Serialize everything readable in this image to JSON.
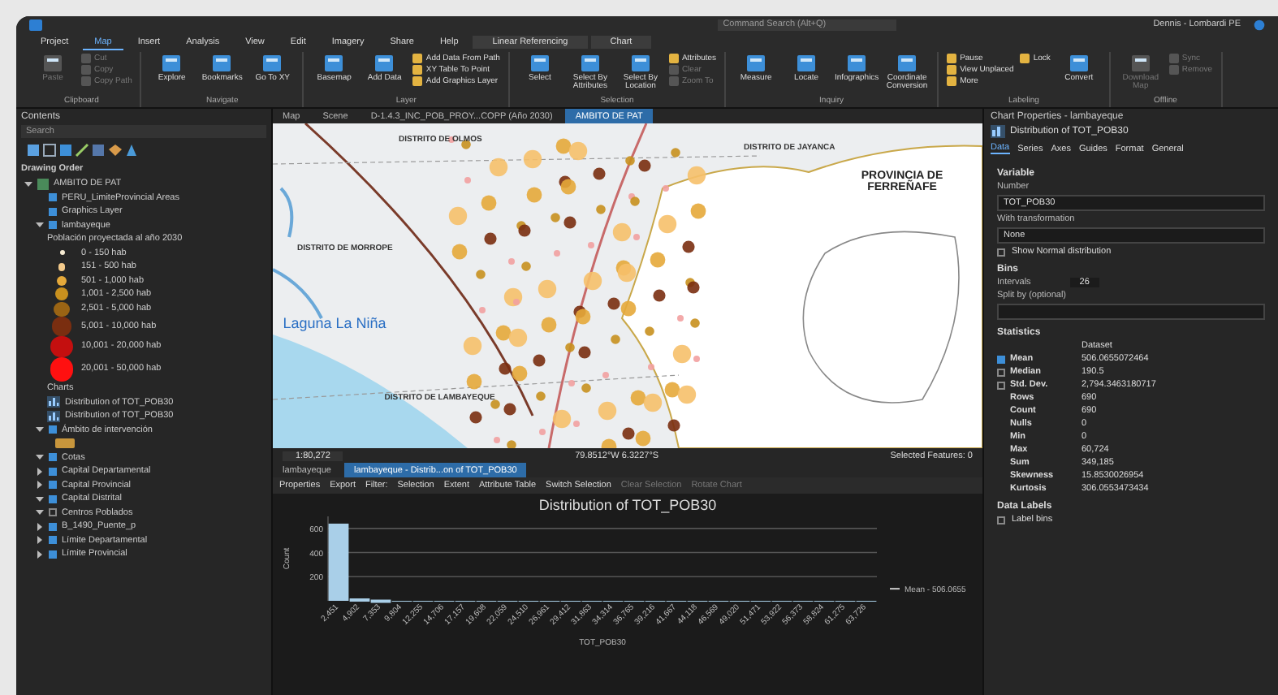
{
  "title_bar": {
    "search": {
      "placeholder": "Command Search (Alt+Q)"
    },
    "user": "Dennis - Lombardi PE"
  },
  "ribbon": {
    "tabs": [
      {
        "label": "Project",
        "selected": false,
        "kind": "normal"
      },
      {
        "label": "Map",
        "selected": true,
        "kind": "normal"
      },
      {
        "label": "Insert",
        "selected": false,
        "kind": "normal"
      },
      {
        "label": "Analysis",
        "selected": false,
        "kind": "normal"
      },
      {
        "label": "View",
        "selected": false,
        "kind": "normal"
      },
      {
        "label": "Edit",
        "selected": false,
        "kind": "normal"
      },
      {
        "label": "Imagery",
        "selected": false,
        "kind": "normal"
      },
      {
        "label": "Share",
        "selected": false,
        "kind": "normal"
      },
      {
        "label": "Help",
        "selected": false,
        "kind": "normal"
      },
      {
        "label": "Linear Referencing",
        "selected": false,
        "kind": "contextual"
      },
      {
        "label": "Chart",
        "selected": false,
        "kind": "contextual"
      }
    ],
    "groups": [
      {
        "label": "Clipboard",
        "buttons": [
          {
            "label": "Paste",
            "kind": "large",
            "disabled": true
          },
          {
            "label": "Cut",
            "kind": "small",
            "disabled": true
          },
          {
            "label": "Copy",
            "kind": "small",
            "disabled": true
          },
          {
            "label": "Copy Path",
            "kind": "small",
            "disabled": true
          }
        ]
      },
      {
        "label": "Navigate",
        "buttons": [
          {
            "label": "Explore",
            "kind": "large",
            "disabled": false
          },
          {
            "label": "Bookmarks",
            "kind": "large",
            "disabled": false
          },
          {
            "label": "Go To XY",
            "kind": "large",
            "disabled": false
          }
        ]
      },
      {
        "label": "Layer",
        "buttons": [
          {
            "label": "Basemap",
            "kind": "large",
            "disabled": false
          },
          {
            "label": "Add Data",
            "kind": "large",
            "disabled": false
          },
          {
            "label": "Add Data From Path",
            "kind": "small",
            "disabled": false
          },
          {
            "label": "XY Table To Point",
            "kind": "small",
            "disabled": false
          },
          {
            "label": "Add Graphics Layer",
            "kind": "small",
            "disabled": false
          }
        ]
      },
      {
        "label": "Selection",
        "buttons": [
          {
            "label": "Select",
            "kind": "large",
            "disabled": false
          },
          {
            "label": "Select By Attributes",
            "kind": "large",
            "disabled": false
          },
          {
            "label": "Select By Location",
            "kind": "large",
            "disabled": false
          },
          {
            "label": "Attributes",
            "kind": "small",
            "disabled": false
          },
          {
            "label": "Clear",
            "kind": "small",
            "disabled": true
          },
          {
            "label": "Zoom To",
            "kind": "small",
            "disabled": true
          }
        ]
      },
      {
        "label": "Inquiry",
        "buttons": [
          {
            "label": "Measure",
            "kind": "large",
            "disabled": false
          },
          {
            "label": "Locate",
            "kind": "large",
            "disabled": false
          },
          {
            "label": "Infographics",
            "kind": "large",
            "disabled": false
          },
          {
            "label": "Coordinate Conversion",
            "kind": "large",
            "disabled": false
          }
        ]
      },
      {
        "label": "Labeling",
        "buttons": [
          {
            "label": "Pause",
            "kind": "small",
            "disabled": false
          },
          {
            "label": "View Unplaced",
            "kind": "small",
            "disabled": false
          },
          {
            "label": "More",
            "kind": "small",
            "disabled": false
          },
          {
            "label": "Lock",
            "kind": "small",
            "disabled": false
          },
          {
            "label": "Convert",
            "kind": "large",
            "disabled": false
          }
        ]
      },
      {
        "label": "Offline",
        "buttons": [
          {
            "label": "Download Map",
            "kind": "large",
            "disabled": true
          },
          {
            "label": "Sync",
            "kind": "small",
            "disabled": true
          },
          {
            "label": "Remove",
            "kind": "small",
            "disabled": true
          }
        ]
      }
    ]
  },
  "contents": {
    "title": "Contents",
    "search": {
      "placeholder": "Search"
    },
    "section": "Drawing Order",
    "items": [
      {
        "kind": "group",
        "label": "AMBITO DE PAT",
        "expanded": true,
        "children": [
          {
            "kind": "layer",
            "label": "PERU_LimiteProvincial Areas",
            "checked": true
          },
          {
            "kind": "layer",
            "label": "Graphics Layer",
            "checked": true
          },
          {
            "kind": "layer",
            "label": "lambayeque",
            "checked": true,
            "expanded": true,
            "children": [
              {
                "kind": "heading",
                "label": "Población proyectada al año 2030"
              },
              {
                "kind": "legend",
                "label": "0 - 150 hab",
                "color": "#f6ead2"
              },
              {
                "kind": "legend",
                "label": "151 - 500 hab",
                "color": "#f2c98a"
              },
              {
                "kind": "legend",
                "label": "501 - 1,000 hab",
                "color": "#e5a93a"
              },
              {
                "kind": "legend",
                "label": "1,001 - 2,500 hab",
                "color": "#c8901e"
              },
              {
                "kind": "legend",
                "label": "2,501 - 5,000 hab",
                "color": "#9a6414"
              },
              {
                "kind": "legend",
                "label": "5,001 - 10,000 hab",
                "color": "#7a2e10"
              },
              {
                "kind": "legend",
                "label": "10,001 - 20,000 hab",
                "color": "#c40f0f"
              },
              {
                "kind": "legend",
                "label": "20,001 - 50,000 hab",
                "color": "#ff1010"
              },
              {
                "kind": "heading",
                "label": "Charts"
              },
              {
                "kind": "chart",
                "label": "Distribution of TOT_POB30"
              },
              {
                "kind": "chart",
                "label": "Distribution of TOT_POB30"
              }
            ]
          },
          {
            "kind": "layer",
            "label": "Ámbito de intervención",
            "checked": true,
            "expanded": true,
            "children": [
              {
                "kind": "swatch",
                "color": "#c8963c"
              }
            ]
          },
          {
            "kind": "layer",
            "label": "Cotas",
            "checked": true,
            "expanded": true
          },
          {
            "kind": "layer",
            "label": "Capital Departamental",
            "checked": true,
            "expanded": false
          },
          {
            "kind": "layer",
            "label": "Capital Provincial",
            "checked": true,
            "expanded": false
          },
          {
            "kind": "layer",
            "label": "Capital Distrital",
            "checked": true,
            "expanded": true
          },
          {
            "kind": "layer",
            "label": "Centros Poblados",
            "checked": false,
            "expanded": true
          },
          {
            "kind": "layer",
            "label": "B_1490_Puente_p",
            "checked": true,
            "expanded": false
          },
          {
            "kind": "layer",
            "label": "Límite Departamental",
            "checked": true,
            "expanded": false
          },
          {
            "kind": "layer",
            "label": "Límite Provincial",
            "checked": true,
            "expanded": false
          }
        ]
      }
    ]
  },
  "map": {
    "tabs": [
      {
        "label": "Map",
        "selected": false
      },
      {
        "label": "Scene",
        "selected": false
      },
      {
        "label": "D-1.4.3_INC_POB_PROY...COPP (Año 2030)",
        "selected": false
      },
      {
        "label": "AMBITO DE PAT",
        "selected": true
      }
    ],
    "labels": [
      {
        "text": "DISTRITO DE OLMOS",
        "kind": "district"
      },
      {
        "text": "DISTRITO DE JAYANCA",
        "kind": "district"
      },
      {
        "text": "PROVINCIA DE FERREÑAFE",
        "kind": "province"
      },
      {
        "text": "DISTRITO DE MORROPE",
        "kind": "district"
      },
      {
        "text": "Laguna La Niña",
        "kind": "water"
      },
      {
        "text": "DISTRITO DE LAMBAYEQUE",
        "kind": "district"
      }
    ],
    "status": {
      "scale": "1:80,272",
      "coordinates": "79.8512°W 6.3227°S",
      "selected": "Selected Features: 0"
    }
  },
  "chart_view": {
    "tabs": [
      {
        "label": "lambayeque",
        "selected": false
      },
      {
        "label": "lambayeque - Distrib...on of TOT_POB30",
        "selected": true
      }
    ],
    "toolbar": [
      {
        "label": "Properties",
        "disabled": false
      },
      {
        "label": "Export",
        "disabled": false
      },
      {
        "label": "Filter:",
        "disabled": false
      },
      {
        "label": "Selection",
        "disabled": false
      },
      {
        "label": "Extent",
        "disabled": false
      },
      {
        "label": "Attribute Table",
        "disabled": false
      },
      {
        "label": "Switch Selection",
        "disabled": false
      },
      {
        "label": "Clear Selection",
        "disabled": true
      },
      {
        "label": "Rotate Chart",
        "disabled": true
      }
    ],
    "mean_legend": "Mean - 506.0655",
    "chart_data": {
      "type": "bar",
      "title": "Distribution of TOT_POB30",
      "xlabel": "TOT_POB30",
      "ylabel": "Count",
      "categories": [
        "2,451",
        "4,902",
        "7,353",
        "9,804",
        "12,255",
        "14,706",
        "17,157",
        "19,608",
        "22,059",
        "24,510",
        "26,961",
        "29,412",
        "31,863",
        "34,314",
        "36,765",
        "39,216",
        "41,667",
        "44,118",
        "46,569",
        "49,020",
        "51,471",
        "53,922",
        "56,373",
        "58,824",
        "61,275",
        "63,726"
      ],
      "values": [
        640,
        20,
        10,
        0,
        0,
        0,
        0,
        0,
        0,
        0,
        0,
        0,
        0,
        0,
        0,
        0,
        0,
        0,
        0,
        0,
        0,
        0,
        0,
        0,
        0,
        0
      ],
      "grid": true,
      "ylim": [
        0,
        700
      ],
      "yticks": [
        200,
        400,
        600
      ]
    }
  },
  "properties": {
    "title": "Chart Properties - lambayeque",
    "chart_name": "Distribution of TOT_POB30",
    "tabs": [
      {
        "label": "Data",
        "selected": true
      },
      {
        "label": "Series",
        "selected": false
      },
      {
        "label": "Axes",
        "selected": false
      },
      {
        "label": "Guides",
        "selected": false
      },
      {
        "label": "Format",
        "selected": false
      },
      {
        "label": "General",
        "selected": false
      }
    ],
    "variable_heading": "Variable",
    "number_label": "Number",
    "number_value": "TOT_POB30",
    "transform_label": "With transformation",
    "transform_value": "None",
    "show_normal": {
      "label": "Show Normal distribution",
      "checked": false
    },
    "bins_heading": "Bins",
    "intervals_label": "Intervals",
    "intervals_value": "26",
    "split_label": "Split by (optional)",
    "stats_heading": "Statistics",
    "stats_column": "Dataset",
    "stats": [
      {
        "label": "Mean",
        "value": "506.0655072464",
        "checked": true
      },
      {
        "label": "Median",
        "value": "190.5",
        "checked": false
      },
      {
        "label": "Std. Dev.",
        "value": "2,794.3463180717",
        "checked": false
      },
      {
        "label": "Rows",
        "value": "690"
      },
      {
        "label": "Count",
        "value": "690"
      },
      {
        "label": "Nulls",
        "value": "0"
      },
      {
        "label": "Min",
        "value": "0"
      },
      {
        "label": "Max",
        "value": "60,724"
      },
      {
        "label": "Sum",
        "value": "349,185"
      },
      {
        "label": "Skewness",
        "value": "15.8530026954"
      },
      {
        "label": "Kurtosis",
        "value": "306.0553473434"
      }
    ],
    "labels_heading": "Data Labels",
    "label_bins": {
      "label": "Label bins",
      "checked": false
    }
  }
}
